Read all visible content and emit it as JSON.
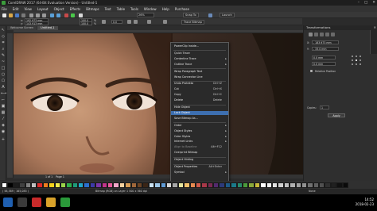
{
  "window": {
    "title": "CorelDRAW 2017 (64-Bit Evaluation Version) - Untitled-1",
    "controls": [
      "–",
      "□",
      "✕"
    ]
  },
  "menu": [
    "File",
    "Edit",
    "View",
    "Layout",
    "Object",
    "Effects",
    "Bitmaps",
    "Text",
    "Table",
    "Tools",
    "Window",
    "Help",
    "Purchase"
  ],
  "toolbar": {
    "zoom": "26%",
    "snap_to": "Snap To",
    "launch": "Launch"
  },
  "property_bar": {
    "x": "192,973 mm",
    "y": "143,913 mm",
    "w": "100,0",
    "h": "100,0",
    "pct": "%",
    "angle": "0,0",
    "trace_bitmap": "Trace Bitmap"
  },
  "doc_tabs": [
    "Welcome Screen",
    "Untitled-1"
  ],
  "context_menu": {
    "items": [
      {
        "label": "PowerClip Inside...",
        "shortcut": "",
        "sub": false,
        "sep_after": true
      },
      {
        "label": "Quick Trace",
        "shortcut": "",
        "sub": false
      },
      {
        "label": "Centerline Trace",
        "shortcut": "",
        "sub": true
      },
      {
        "label": "Outline Trace",
        "shortcut": "",
        "sub": true,
        "sep_after": true
      },
      {
        "label": "Wrap Paragraph Text",
        "shortcut": "",
        "sub": false
      },
      {
        "label": "Wrap Connector Line",
        "shortcut": "",
        "sub": false,
        "sep_after": true
      },
      {
        "label": "Undo Protekta",
        "shortcut": "Ctrl+Z",
        "sub": false
      },
      {
        "label": "Cut",
        "shortcut": "Ctrl+X",
        "sub": false
      },
      {
        "label": "Copy",
        "shortcut": "Ctrl+C",
        "sub": false
      },
      {
        "label": "Delete",
        "shortcut": "Delete",
        "sub": false,
        "sep_after": true
      },
      {
        "label": "Hide Object",
        "shortcut": "",
        "sub": false
      },
      {
        "label": "Lock Object",
        "shortcut": "",
        "sub": false,
        "highlight": true
      },
      {
        "label": "Save Bitmap As...",
        "shortcut": "",
        "sub": false,
        "sep_after": true
      },
      {
        "label": "Order",
        "shortcut": "",
        "sub": true
      },
      {
        "label": "Object Styles",
        "shortcut": "",
        "sub": true
      },
      {
        "label": "Color Styles",
        "shortcut": "",
        "sub": true
      },
      {
        "label": "Internet Links",
        "shortcut": "",
        "sub": true
      },
      {
        "label": "Align to Baseline",
        "shortcut": "Alt+F12",
        "sub": false,
        "dim": true
      },
      {
        "label": "Overprint Bitmap",
        "shortcut": "",
        "sub": false,
        "sep_after": true
      },
      {
        "label": "Object Hinting",
        "shortcut": "",
        "sub": false,
        "sep_after": true
      },
      {
        "label": "Object Properties",
        "shortcut": "Alt+Enter",
        "sub": false
      },
      {
        "label": "Symbol",
        "shortcut": "",
        "sub": true
      }
    ]
  },
  "docker": {
    "title": "Transformations",
    "x_value": "- 183,973 mm",
    "y_value": "- 33,0 mm",
    "h_value": "0,0 mm",
    "v_value": "0,0 mm",
    "relative_position": "Relative Position",
    "copies_label": "Copies:",
    "copies_value": "1",
    "apply": "Apply"
  },
  "page_nav": {
    "page_label": "Page 1",
    "counter": "1 of 1"
  },
  "status": {
    "coords": "( 58,589 ; 165,085 )",
    "object_info": "Bitmap (RGB) on Layer 1 500 x 360 dpi",
    "fill": "None"
  },
  "taskbar": {
    "time": "14:52",
    "date": "2018-02-23"
  },
  "colors": {
    "highlight": "#3d6fb0",
    "palette": [
      "#ffffff",
      "#000000",
      "#1c1c1c",
      "#404040",
      "#808080",
      "#bfbfbf",
      "#e02a2a",
      "#f07c1e",
      "#f6d21d",
      "#f0ec4c",
      "#9bd34a",
      "#2fae4b",
      "#1d9a7a",
      "#22a6c9",
      "#2a6fcf",
      "#3d3aa8",
      "#7b36a8",
      "#c2348a",
      "#e85a9c",
      "#f3a6c8",
      "#f7d2a0",
      "#d89c54",
      "#a0673a",
      "#6b4324",
      "#3a2516",
      "#cbe2f2",
      "#9ec7e8",
      "#5f9ad4",
      "#d6d6d6",
      "#a6a6a6",
      "#e6e6a0",
      "#f4c06a",
      "#e68a50",
      "#d05a4a",
      "#a83848",
      "#7a2a52",
      "#532a6e",
      "#2c3a7a",
      "#1d5a88",
      "#1a7a8a",
      "#2a8a6a",
      "#4a9a3a",
      "#8aa83a",
      "#c8b83a",
      "#ffffff",
      "#f0f0f0",
      "#e0e0e0",
      "#d0d0d0",
      "#c0c0c0",
      "#b0b0b0",
      "#a0a0a0",
      "#909090",
      "#707070",
      "#606060",
      "#505050",
      "#303030",
      "#202020",
      "#101010",
      "#0a0a0a"
    ]
  }
}
